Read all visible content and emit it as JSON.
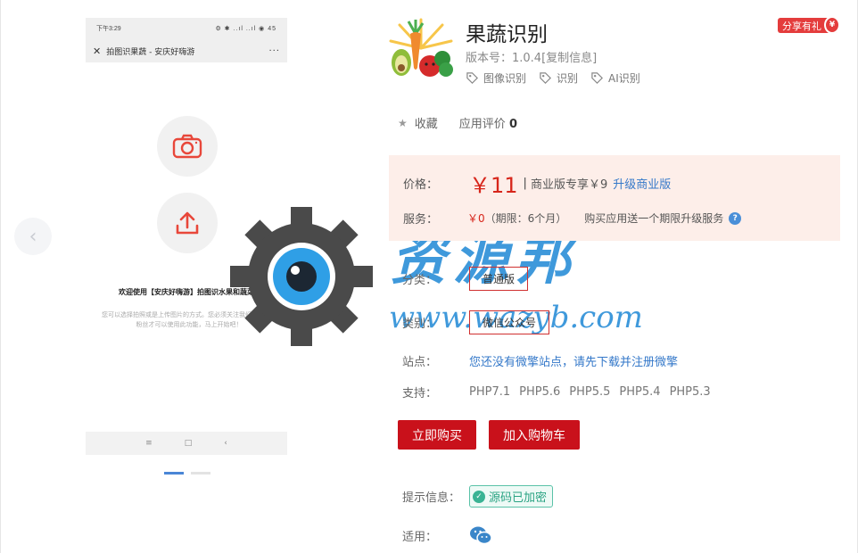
{
  "phone": {
    "status_time": "下午3:29",
    "status_icons": "⚙   ✱ ..ıl ..ıl ◉ 45",
    "title": "拍图识果蔬 - 安庆好嗨游",
    "more": "···",
    "welcome": "欢迎使用【安庆好嗨游】拍图识水果和蔬菜",
    "desc": "您可以选择拍照或是上传图片的方式。您必须关注我们的公众号粉丝才可以使用此功能，马上开始吧！",
    "nav_menu": "≡",
    "nav_home": "□",
    "nav_back": "‹"
  },
  "carousel": {
    "prev": "‹",
    "active_slide": 1,
    "slide_count": 2
  },
  "watermark": {
    "text": "资源邦",
    "url": "www.wazyb.com"
  },
  "app": {
    "name": "果蔬识别",
    "version_label": "版本号：1.0.4",
    "copy_label": "[复制信息]",
    "tags": [
      "图像识别",
      "识别",
      "AI识别"
    ]
  },
  "share": {
    "label": "分享有礼",
    "gift": "¥"
  },
  "fav": {
    "label": "收藏",
    "rating_label": "应用评价",
    "rating_value": "0"
  },
  "price": {
    "label": "价格：",
    "value": "￥11",
    "sep": "|",
    "pro": "商业版专享￥9",
    "upgrade": "升级商业版"
  },
  "service": {
    "label": "服务：",
    "free": "￥0",
    "period": "（期限：6个月）",
    "note": "购买应用送一个期限升级服务",
    "help": "?"
  },
  "edition": {
    "label": "分类：",
    "option": "普通版"
  },
  "category": {
    "label": "类别：",
    "option": "微信公众号"
  },
  "site": {
    "label": "站点：",
    "value": "您还没有微擎站点，请先下载并注册微擎"
  },
  "support": {
    "label": "支持：",
    "versions": [
      "PHP7.1",
      "PHP5.6",
      "PHP5.5",
      "PHP5.4",
      "PHP5.3"
    ]
  },
  "actions": {
    "buy": "立即购买",
    "cart": "加入购物车"
  },
  "hint": {
    "label": "提示信息：",
    "badge": "源码已加密"
  },
  "apply": {
    "label": "适用："
  },
  "colors": {
    "accent_red": "#c9111b",
    "link_blue": "#3478c9",
    "price_red": "#d7261b",
    "price_bg": "#fdeee9"
  }
}
